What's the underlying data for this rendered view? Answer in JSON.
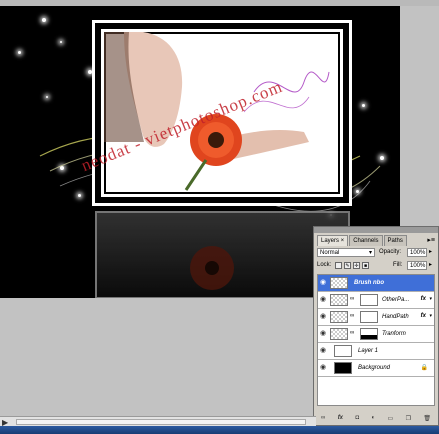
{
  "canvas": {
    "watermark": "neodat - vietphotoshop.com"
  },
  "layers_panel": {
    "tabs": [
      {
        "label": "Layers ×"
      },
      {
        "label": "Channels"
      },
      {
        "label": "Paths"
      }
    ],
    "menu_icon": "panel-menu-icon",
    "blend_mode": "Normal",
    "opacity_label": "Opacity:",
    "opacity_value": "100%",
    "lock_label": "Lock:",
    "fill_label": "Fill:",
    "fill_value": "100%",
    "layers": [
      {
        "name": "Brush nbo",
        "selected": true
      },
      {
        "name": "OtherPa...",
        "fx": "fx"
      },
      {
        "name": "HandPath",
        "fx": "fx"
      },
      {
        "name": "Tranform"
      },
      {
        "name": "Layer 1"
      },
      {
        "name": "Background"
      }
    ],
    "bottom_icons": [
      "link-icon",
      "fx-icon",
      "mask-icon",
      "adjustment-icon",
      "group-icon",
      "new-layer-icon",
      "trash-icon"
    ]
  },
  "colors": {
    "selection": "#3f6fd8",
    "watermark": "#c0202a",
    "taskbar": "#2c5aa0"
  }
}
